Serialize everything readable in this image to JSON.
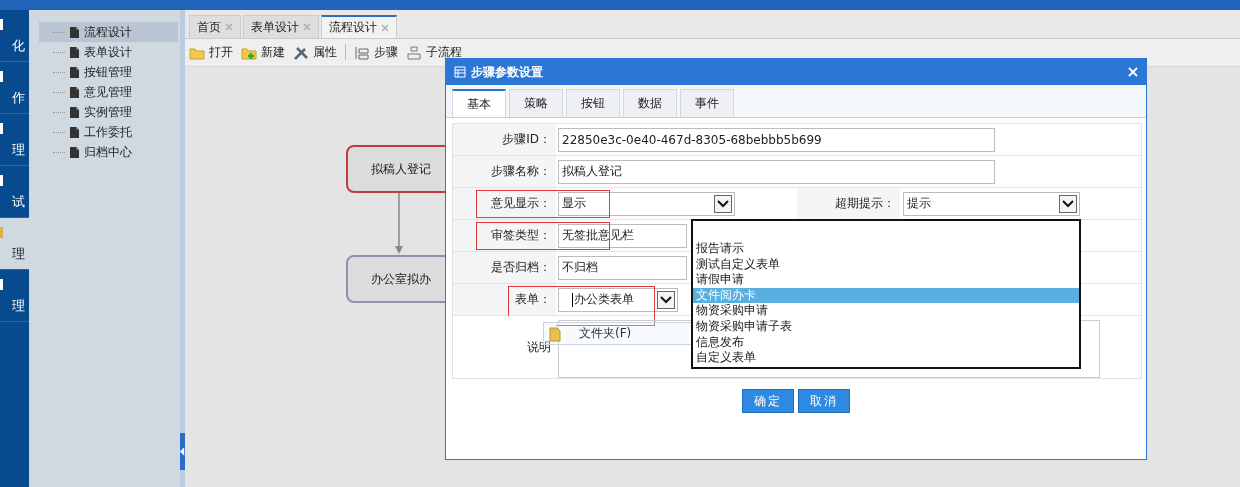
{
  "side_nav": [
    {
      "label": "化",
      "selected": false
    },
    {
      "label": "作",
      "selected": false
    },
    {
      "label": "理",
      "selected": false
    },
    {
      "label": "试",
      "selected": false
    },
    {
      "label": "理",
      "selected": true
    },
    {
      "label": "理",
      "selected": false
    }
  ],
  "tree": {
    "items": [
      {
        "label": "流程设计",
        "selected": true
      },
      {
        "label": "表单设计",
        "selected": false
      },
      {
        "label": "按钮管理",
        "selected": false
      },
      {
        "label": "意见管理",
        "selected": false
      },
      {
        "label": "实例管理",
        "selected": false
      },
      {
        "label": "工作委托",
        "selected": false
      },
      {
        "label": "归档中心",
        "selected": false
      }
    ]
  },
  "tabs": [
    {
      "label": "首页",
      "selected": false
    },
    {
      "label": "表单设计",
      "selected": false
    },
    {
      "label": "流程设计",
      "selected": true
    }
  ],
  "toolbar": [
    {
      "label": "打开",
      "kind": "folder"
    },
    {
      "label": "新建",
      "kind": "new"
    },
    {
      "label": "属性",
      "kind": "tools"
    },
    {
      "label": "步骤",
      "kind": "step"
    },
    {
      "label": "子流程",
      "kind": "subflow"
    }
  ],
  "diagram": {
    "nodes": [
      {
        "label": "拟稿人登记",
        "selected": true
      },
      {
        "label": "办公室拟办",
        "selected": false
      }
    ]
  },
  "dialog": {
    "title": "步骤参数设置",
    "tabs": [
      {
        "label": "基本",
        "selected": true
      },
      {
        "label": "策略",
        "selected": false
      },
      {
        "label": "按钮",
        "selected": false
      },
      {
        "label": "数据",
        "selected": false
      },
      {
        "label": "事件",
        "selected": false
      }
    ],
    "fields": [
      {
        "kind": "input",
        "label": "步骤ID：",
        "value": "22850e3c-0e40-467d-8305-68bebbb5b699",
        "highlighted": false
      },
      {
        "kind": "input",
        "label": "步骤名称：",
        "value": "拟稿人登记",
        "highlighted": false
      },
      {
        "kind": "select",
        "label": "意见显示：",
        "value": "显示",
        "highlighted": true,
        "extra": {
          "label": "超期提示：",
          "value": "提示"
        }
      },
      {
        "kind": "field",
        "label": "审签类型：",
        "value": "无签批意见栏",
        "highlighted": true
      },
      {
        "kind": "field",
        "label": "是否归档：",
        "value": "不归档",
        "highlighted": false
      },
      {
        "kind": "combo",
        "label": "表单：",
        "value": "办公类表单",
        "highlighted": true
      },
      {
        "kind": "textarea",
        "label": "说明",
        "highlighted": false
      }
    ],
    "dropdown": {
      "options": [
        {
          "label": "报告请示",
          "selected": false
        },
        {
          "label": "测试自定义表单",
          "selected": false
        },
        {
          "label": "请假申请",
          "selected": false
        },
        {
          "label": "文件阅办卡",
          "selected": true
        },
        {
          "label": "物资采购申请",
          "selected": false
        },
        {
          "label": "物资采购申请子表",
          "selected": false
        },
        {
          "label": "信息发布",
          "selected": false
        },
        {
          "label": "自定义表单",
          "selected": false
        }
      ]
    },
    "buttons": [
      "确定",
      "取消"
    ]
  },
  "context_tip": {
    "label": "文件夹(F)"
  }
}
